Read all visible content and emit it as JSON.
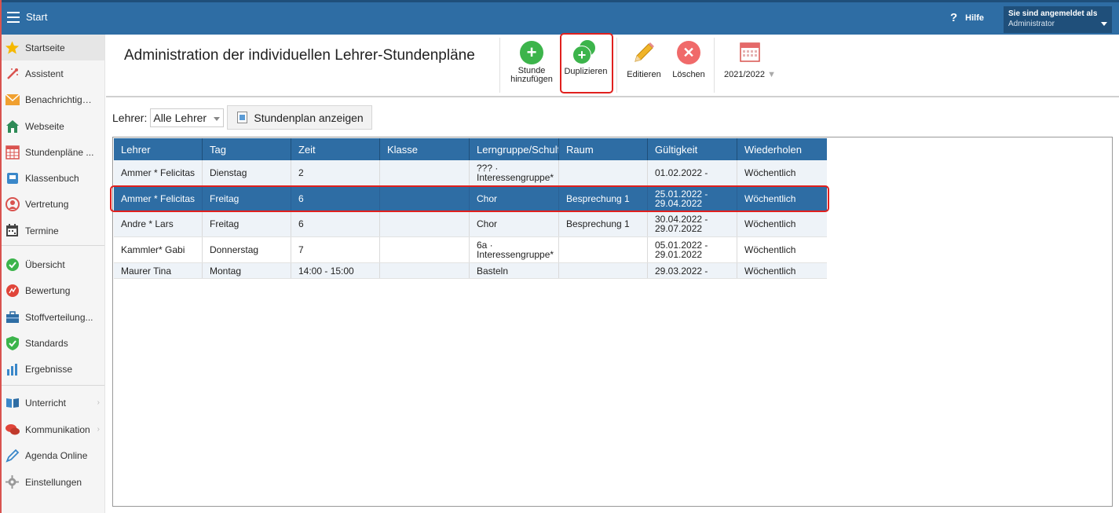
{
  "topbar": {
    "menu_icon": "hamburger-menu-icon",
    "title": "Start",
    "help_label": "Hilfe",
    "help_icon": "question-icon",
    "user": {
      "line1": "Sie sind angemeldet als",
      "line2": "Administrator"
    },
    "color": "#2e6da4"
  },
  "sidebar": {
    "items": [
      {
        "label": "Startseite",
        "icon": "star-icon",
        "active": true
      },
      {
        "label": "Assistent",
        "icon": "magic-wand-icon"
      },
      {
        "label": "Benachrichtigu...",
        "icon": "envelope-icon"
      },
      {
        "label": "Webseite",
        "icon": "home-icon"
      },
      {
        "label": "Stundenpläne ...",
        "icon": "timetable-icon"
      },
      {
        "label": "Klassenbuch",
        "icon": "classbook-icon"
      },
      {
        "label": "Vertretung",
        "icon": "substitute-person-icon"
      },
      {
        "label": "Termine",
        "icon": "calendar-icon"
      },
      {
        "label": "Übersicht",
        "icon": "check-circle-icon"
      },
      {
        "label": "Bewertung",
        "icon": "rating-icon"
      },
      {
        "label": "Stoffverteilung...",
        "icon": "briefcase-icon"
      },
      {
        "label": "Standards",
        "icon": "shield-check-icon"
      },
      {
        "label": "Ergebnisse",
        "icon": "bar-chart-icon"
      },
      {
        "label": "Unterricht",
        "icon": "book-icon"
      },
      {
        "label": "Kommunikation",
        "icon": "chat-icon"
      },
      {
        "label": "Agenda Online",
        "icon": "pen-icon"
      },
      {
        "label": "Einstellungen",
        "icon": "gear-icon"
      }
    ]
  },
  "header": {
    "title": "Administration der individuellen Lehrer-Stundenpläne",
    "toolbar": {
      "add_line1": "Stunde",
      "add_line2": "hinzufügen",
      "duplicate": "Duplizieren",
      "edit": "Editieren",
      "delete": "Löschen",
      "year": "2021/2022"
    }
  },
  "filter": {
    "label": "Lehrer:",
    "selected": "Alle Lehrer",
    "show_button": "Stundenplan anzeigen"
  },
  "table": {
    "columns": [
      "Lehrer",
      "Tag",
      "Zeit",
      "Klasse",
      "Lerngruppe/Schulfa",
      "Raum",
      "Gültigkeit",
      "Wiederholen"
    ],
    "rows": [
      {
        "lehrer": "Ammer * Felicitas",
        "tag": "Dienstag",
        "zeit": "2",
        "klasse": "",
        "lern1": "??? ·",
        "lern2": "Interessengruppe*",
        "raum": "",
        "gueltig1": "01.02.2022 -",
        "gueltig2": "",
        "wiederholen": "Wöchentlich"
      },
      {
        "lehrer": "Ammer * Felicitas",
        "tag": "Freitag",
        "zeit": "6",
        "klasse": "",
        "lern1": "Chor",
        "lern2": "",
        "raum": "Besprechung 1",
        "gueltig1": "25.01.2022 -",
        "gueltig2": "29.04.2022",
        "wiederholen": "Wöchentlich"
      },
      {
        "lehrer": "Andre * Lars",
        "tag": "Freitag",
        "zeit": "6",
        "klasse": "",
        "lern1": "Chor",
        "lern2": "",
        "raum": "Besprechung 1",
        "gueltig1": "30.04.2022 -",
        "gueltig2": "29.07.2022",
        "wiederholen": "Wöchentlich"
      },
      {
        "lehrer": "Kammler* Gabi",
        "tag": "Donnerstag",
        "zeit": "7",
        "klasse": "",
        "lern1": "6a ·",
        "lern2": "Interessengruppe*",
        "raum": "",
        "gueltig1": "05.01.2022 -",
        "gueltig2": "29.01.2022",
        "wiederholen": "Wöchentlich"
      },
      {
        "lehrer": "Maurer Tina",
        "tag": "Montag",
        "zeit": "14:00 - 15:00",
        "klasse": "",
        "lern1": "Basteln",
        "lern2": "",
        "raum": "",
        "gueltig1": "29.03.2022 -",
        "gueltig2": "",
        "wiederholen": "Wöchentlich"
      }
    ]
  }
}
